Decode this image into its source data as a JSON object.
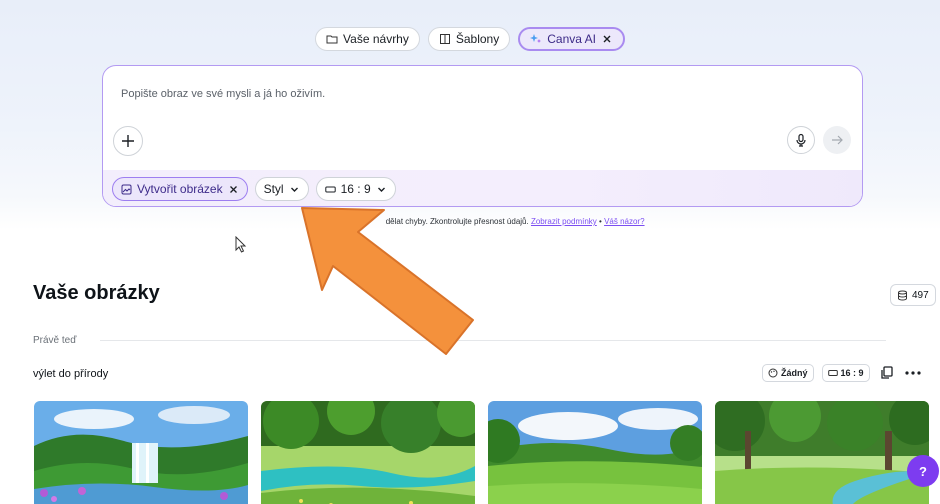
{
  "tabs": [
    {
      "label": "Vaše návrhy",
      "icon": "folder-icon"
    },
    {
      "label": "Šablony",
      "icon": "template-icon"
    },
    {
      "label": "Canva AI",
      "icon": "sparkle-icon",
      "active": true
    }
  ],
  "prompt": {
    "placeholder": "Popište obraz ve své mysli a já ho oživím."
  },
  "footer_chips": {
    "create_label": "Vytvořit obrázek",
    "style_label": "Styl",
    "ratio_label": "16 : 9"
  },
  "disclaimer": {
    "visible_start": "Ca",
    "text": "dělat chyby. Zkontrolujte přesnost údajů.",
    "terms_link": "Zobrazit podmínky",
    "separator": "•",
    "feedback_link": "Váš názor?"
  },
  "section": {
    "title": "Vaše obrázky",
    "credits": "497",
    "group_label": "Právě teď"
  },
  "result": {
    "prompt_text": "výlet do přírody",
    "style_value": "Žádný",
    "ratio_value": "16 : 9"
  },
  "help_label": "?",
  "colors": {
    "accent": "#7d3cf0",
    "chip_border": "#9d7ef0",
    "annotation_arrow": "#f4913c"
  }
}
